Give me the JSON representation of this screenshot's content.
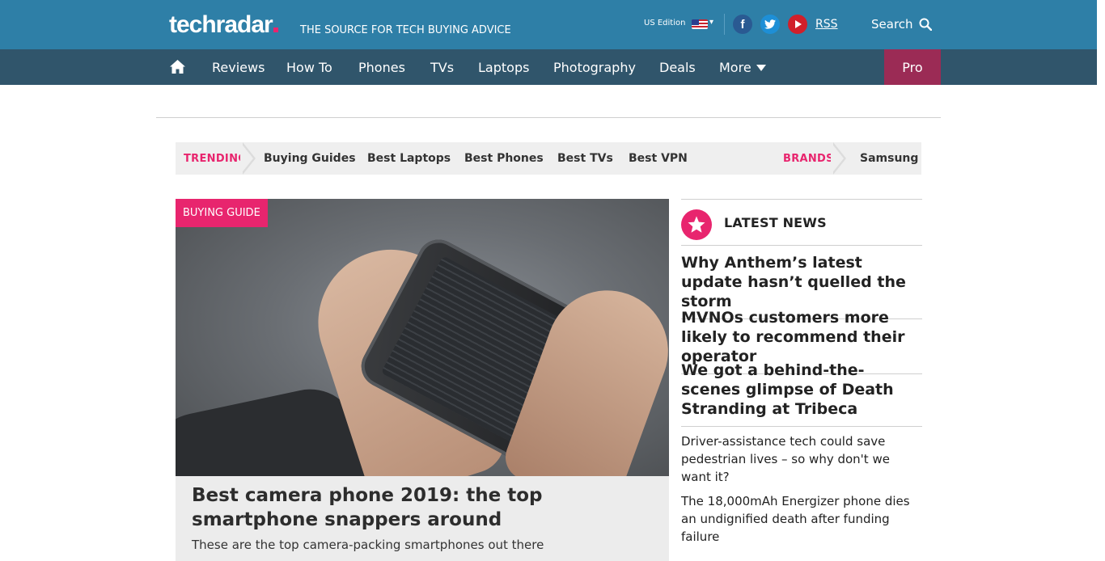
{
  "header": {
    "logo": "techradar",
    "tagline": "THE SOURCE FOR TECH BUYING ADVICE",
    "edition": "US Edition",
    "rss": "RSS",
    "search": "Search"
  },
  "nav": {
    "items": [
      "Reviews",
      "How To",
      "Phones",
      "TVs",
      "Laptops",
      "Photography",
      "Deals",
      "More"
    ],
    "pro": "Pro"
  },
  "trending": {
    "label": "TRENDING",
    "links": [
      "Buying Guides",
      "Best Laptops",
      "Best Phones",
      "Best TVs",
      "Best VPN"
    ],
    "brands_label": "BRANDS",
    "brands": [
      "Samsung"
    ]
  },
  "hero": {
    "badge": "BUYING GUIDE",
    "title": "Best camera phone 2019: the top smartphone snappers around",
    "subtitle": "These are the top camera-packing smartphones out there"
  },
  "latest": {
    "title": "LATEST NEWS",
    "headlines": [
      "Why Anthem’s latest update hasn’t quelled the storm",
      "MVNOs customers more likely to recommend their operator",
      "We got a behind-the-scenes glimpse of Death Stranding at Tribeca"
    ],
    "more": [
      "Driver-assistance tech could save pedestrian lives – so why don't we want it?",
      "The 18,000mAh Energizer phone dies an undignified death after funding failure"
    ]
  },
  "colors": {
    "header_bg": "#2e7fa7",
    "nav_bg": "#30556b",
    "accent": "#e8256e",
    "pro_bg": "#9b2b55"
  }
}
